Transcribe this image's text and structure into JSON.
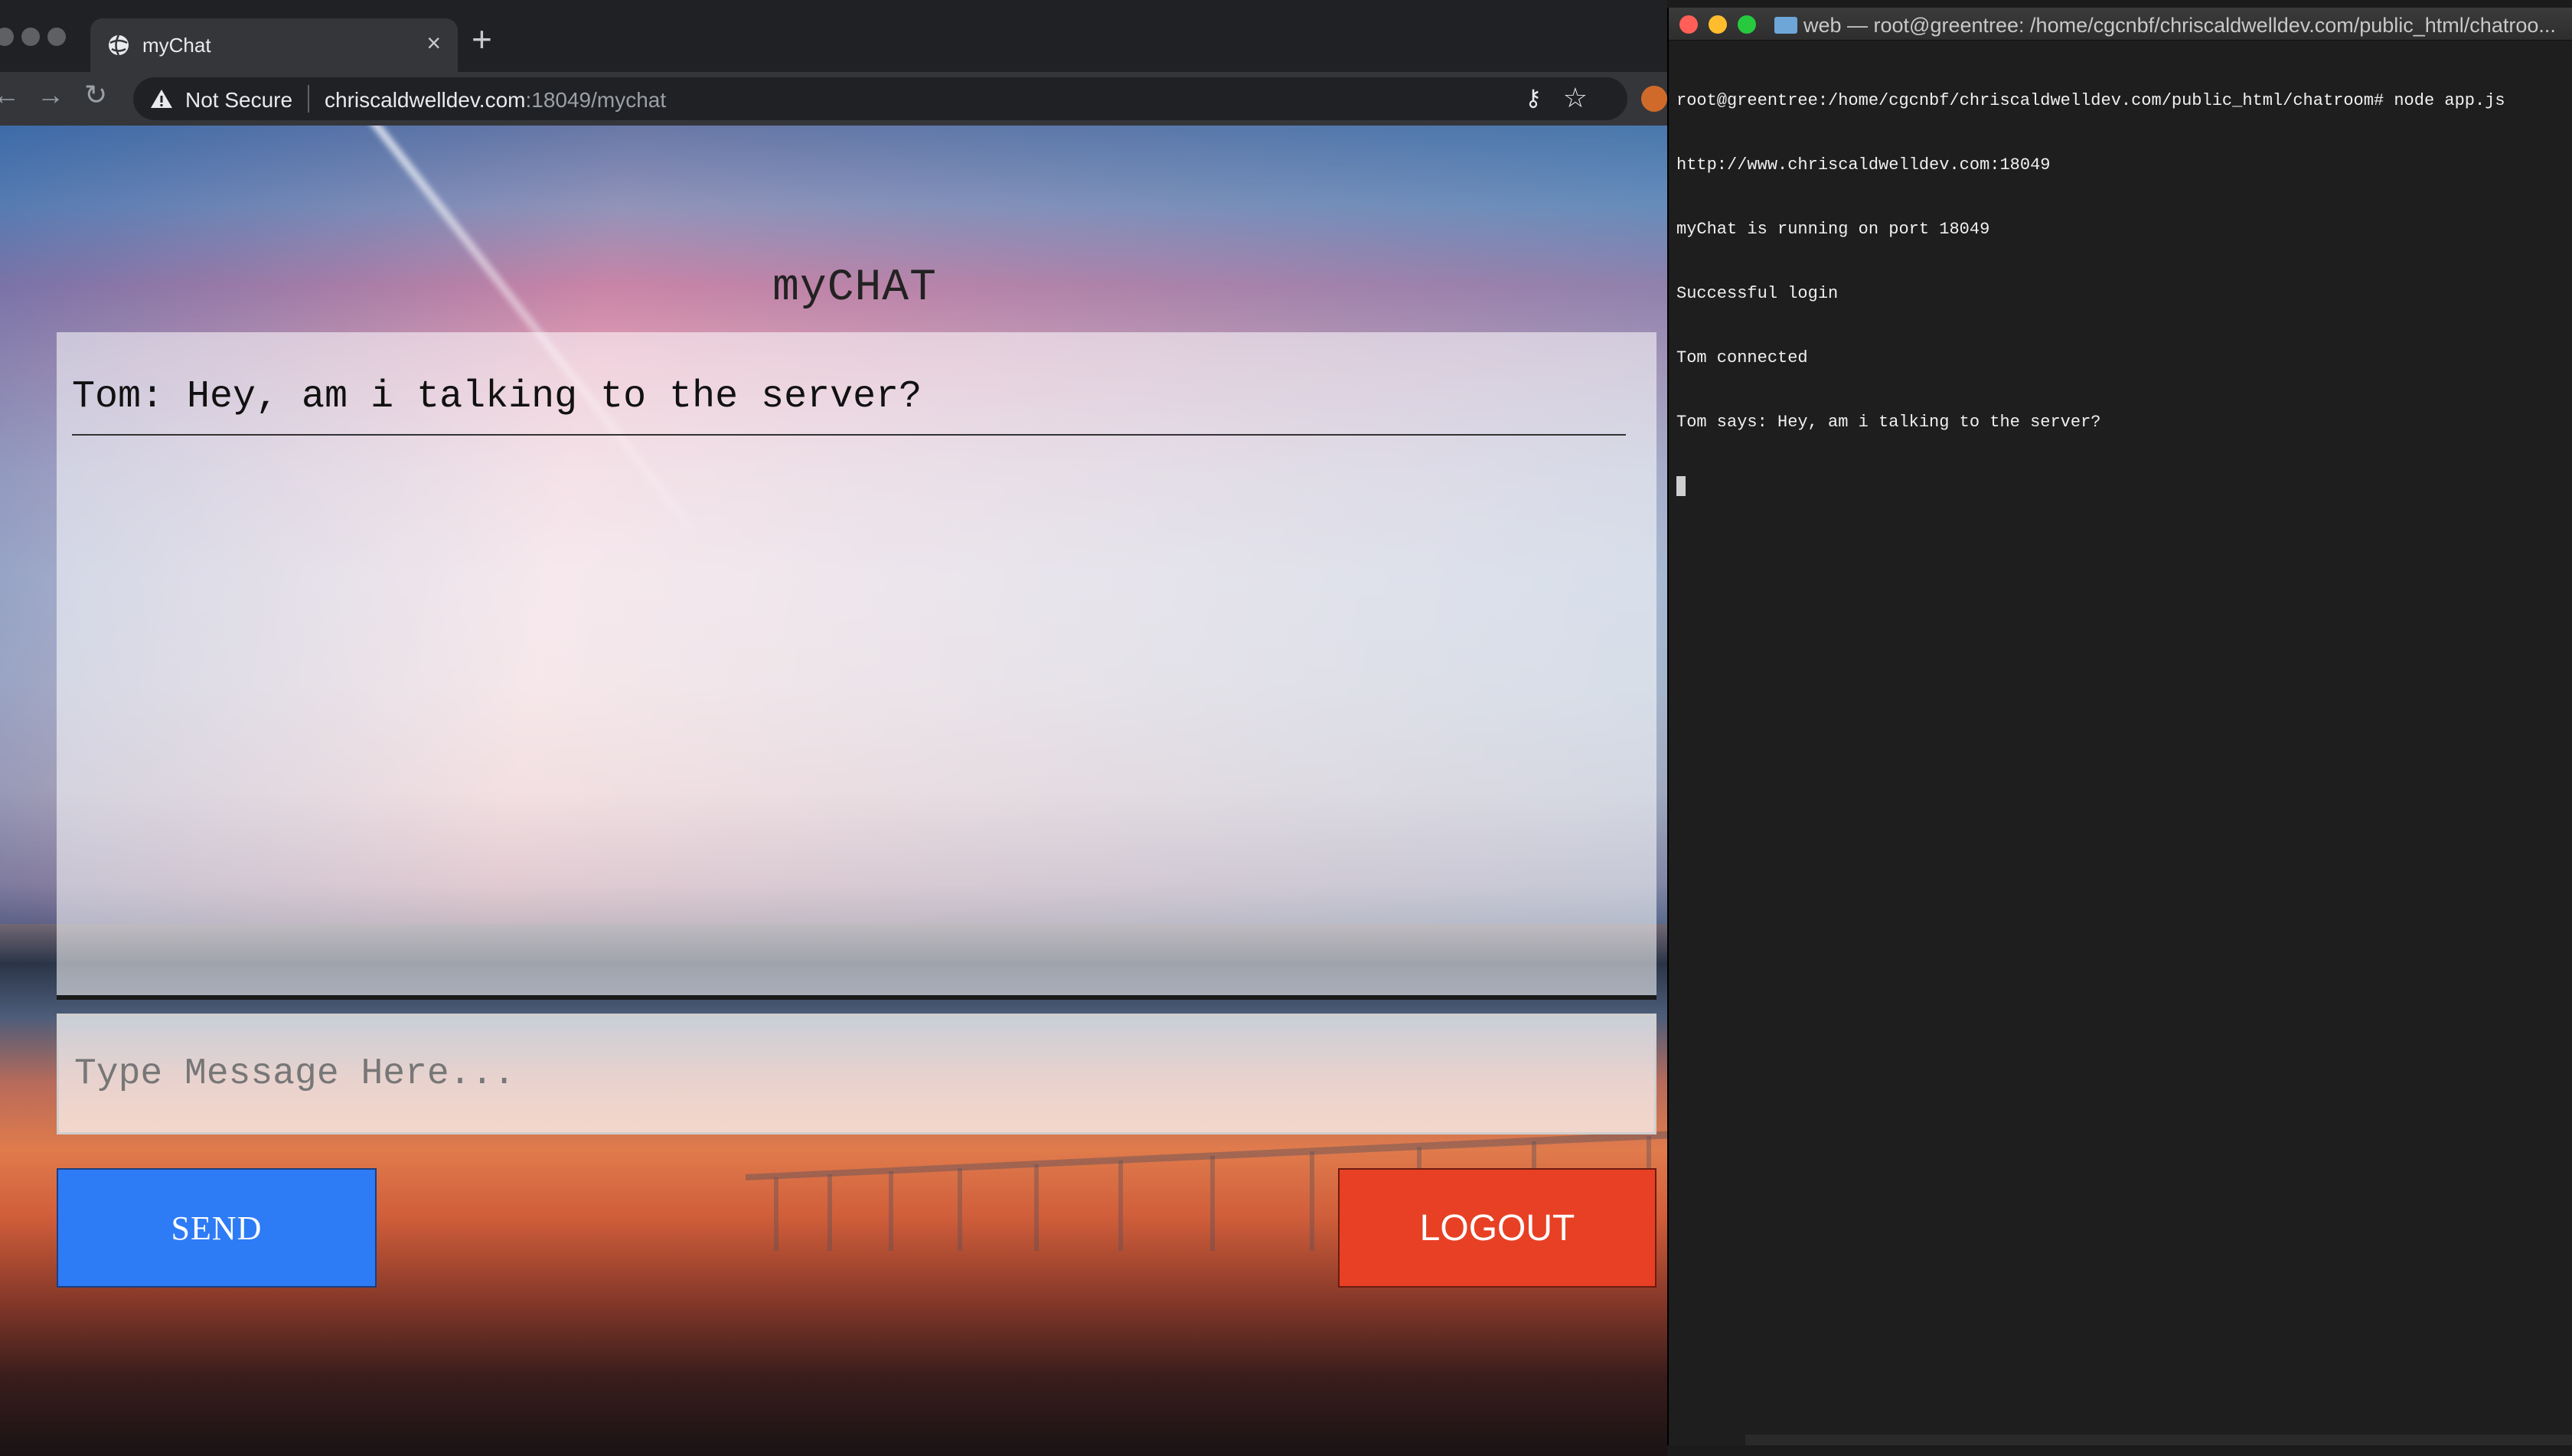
{
  "browser": {
    "tab_title": "myChat",
    "tab_close": "×",
    "new_tab": "+",
    "security_label": "Not Secure",
    "url_host": "chriscaldwelldev.com",
    "url_rest": ":18049/mychat"
  },
  "app": {
    "title": "myCHAT",
    "messages": [
      {
        "text": "Tom: Hey, am i talking to the server?"
      }
    ],
    "input_placeholder": "Type Message Here...",
    "input_value": "",
    "send_label": "SEND",
    "logout_label": "LOGOUT",
    "colors": {
      "send": "#2e7bf6",
      "logout": "#e84024"
    }
  },
  "terminal": {
    "title": "web — root@greentree: /home/cgcnbf/chriscaldwelldev.com/public_html/chatroo...",
    "lines": [
      "root@greentree:/home/cgcnbf/chriscaldwelldev.com/public_html/chatroom# node app.js",
      "http://www.chriscaldwelldev.com:18049",
      "myChat is running on port 18049",
      "Successful login",
      "Tom connected",
      "Tom says: Hey, am i talking to the server?"
    ]
  }
}
